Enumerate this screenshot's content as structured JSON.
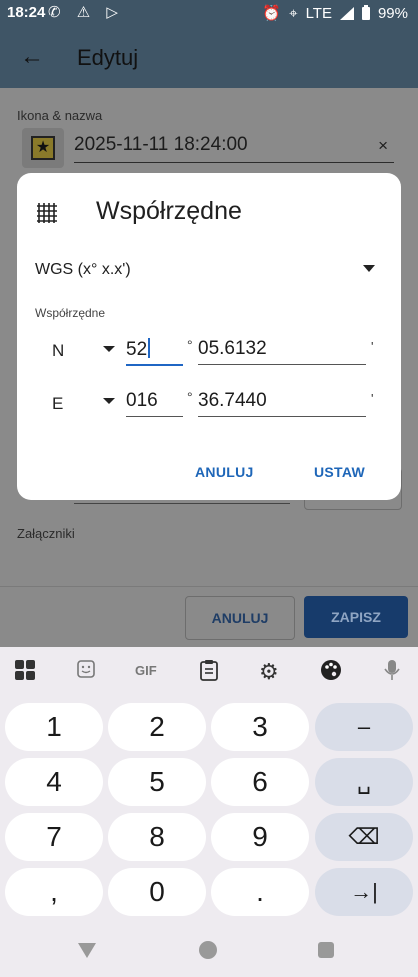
{
  "status": {
    "time": "18:24",
    "notif_icons": "✆ ⚠ ▷",
    "lte": "LTE",
    "battery": "99%"
  },
  "appbar": {
    "title": "Edytuj"
  },
  "form": {
    "icon_name_label": "Ikona & nazwa",
    "name_value": "2025-11-11 18:24:00",
    "clear_symbol": "×",
    "attachments_label": "Załączniki",
    "cancel": "ANULUJ",
    "save": "ZAPISZ"
  },
  "dialog": {
    "title": "Współrzędne",
    "format": "WGS (x° x.x')",
    "section_label": "Współrzędne",
    "lat": {
      "dir": "N",
      "deg": "52",
      "min": "05.6132"
    },
    "lon": {
      "dir": "E",
      "deg": "016",
      "min": "36.7440"
    },
    "deg_symbol": "°",
    "min_symbol": "'",
    "cancel": "ANULUJ",
    "ok": "USTAW"
  },
  "keyboard": {
    "toolbar": [
      "apps-icon",
      "sticker-icon",
      "GIF",
      "clipboard-icon",
      "settings-icon",
      "palette-icon",
      "mic-icon"
    ],
    "gif_label": "GIF",
    "rows": [
      [
        "1",
        "2",
        "3",
        "–"
      ],
      [
        "4",
        "5",
        "6",
        "␣"
      ],
      [
        "7",
        "8",
        "9",
        "⌫"
      ],
      [
        ",",
        "0",
        ".",
        "→|"
      ]
    ]
  },
  "colors": {
    "accent": "#1e66b8",
    "appbar": "#3f5566",
    "save_button": "#173b6b"
  }
}
